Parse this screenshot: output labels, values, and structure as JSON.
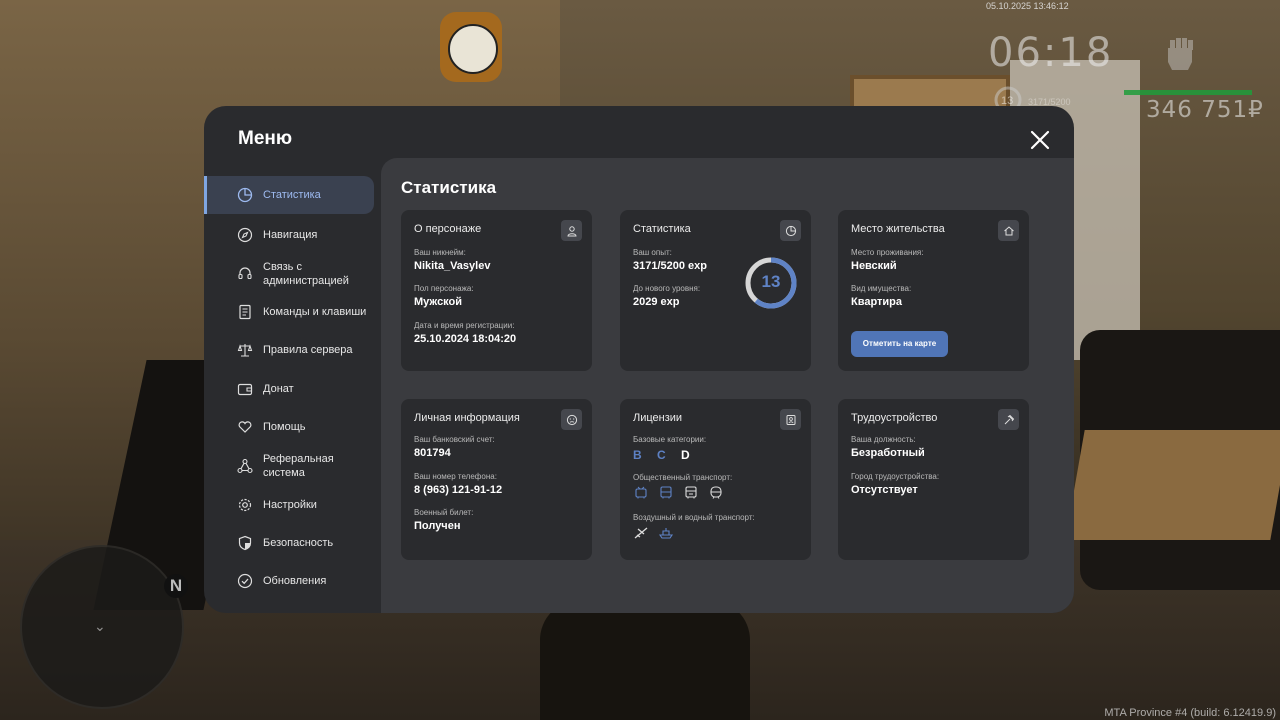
{
  "hud": {
    "datetime": "05.10.2025 13:46:12",
    "time": "06:18",
    "level": "13",
    "exp": "3171/5200",
    "money": "346 751₽",
    "minimap_north": "N",
    "build_info": "MTA Province #4 (build: 6.12419.9)"
  },
  "menu": {
    "title": "Меню",
    "sidebar": [
      {
        "label": "Статистика",
        "icon": "pie-chart-icon"
      },
      {
        "label": "Навигация",
        "icon": "compass-icon"
      },
      {
        "label": "Связь с администрацией",
        "icon": "headset-icon"
      },
      {
        "label": "Команды и клавиши",
        "icon": "document-icon"
      },
      {
        "label": "Правила сервера",
        "icon": "scales-icon"
      },
      {
        "label": "Донат",
        "icon": "wallet-icon"
      },
      {
        "label": "Помощь",
        "icon": "heart-hands-icon"
      },
      {
        "label": "Реферальная система",
        "icon": "network-icon"
      },
      {
        "label": "Настройки",
        "icon": "gear-icon"
      },
      {
        "label": "Безопасность",
        "icon": "shield-icon"
      },
      {
        "label": "Обновления",
        "icon": "check-circle-icon"
      }
    ],
    "active_item": "Статистика"
  },
  "content": {
    "title": "Статистика",
    "character": {
      "title": "О персонаже",
      "nickname_label": "Ваш никнейм:",
      "nickname": "Nikita_Vasylev",
      "gender_label": "Пол персонажа:",
      "gender": "Мужской",
      "reg_label": "Дата и время регистрации:",
      "reg_value": "25.10.2024 18:04:20"
    },
    "stats": {
      "title": "Статистика",
      "exp_label": "Ваш опыт:",
      "exp_value": "3171/5200 exp",
      "next_label": "До нового уровня:",
      "next_value": "2029 exp",
      "level": "13",
      "progress": 0.61
    },
    "residence": {
      "title": "Место жительства",
      "place_label": "Место проживания:",
      "place_value": "Невский",
      "property_label": "Вид имущества:",
      "property_value": "Квартира",
      "map_button": "Отметить на карте"
    },
    "personal": {
      "title": "Личная информация",
      "bank_label": "Ваш банковский счет:",
      "bank_value": "801794",
      "phone_label": "Ваш номер телефона:",
      "phone_value": "8 (963) 121-91-12",
      "military_label": "Военный билет:",
      "military_value": "Получен"
    },
    "licenses": {
      "title": "Лицензии",
      "base_label": "Базовые категории:",
      "categories": [
        {
          "name": "B",
          "owned": false
        },
        {
          "name": "C",
          "owned": false
        },
        {
          "name": "D",
          "owned": true
        }
      ],
      "public_label": "Общественный транспорт:",
      "public_icons": [
        "trolleybus-icon",
        "bus-icon",
        "tram-icon",
        "metro-icon"
      ],
      "air_label": "Воздушный и водный транспорт:",
      "air_icons": [
        "airplane-icon",
        "boat-icon"
      ]
    },
    "employment": {
      "title": "Трудоустройство",
      "position_label": "Ваша должность:",
      "position_value": "Безработный",
      "city_label": "Город трудоустройства:",
      "city_value": "Отсутствует"
    }
  },
  "colors": {
    "accent": "#5f83c6",
    "button": "#5075b7",
    "panel": "#2a2b2e",
    "content": "#3a3b3f"
  }
}
